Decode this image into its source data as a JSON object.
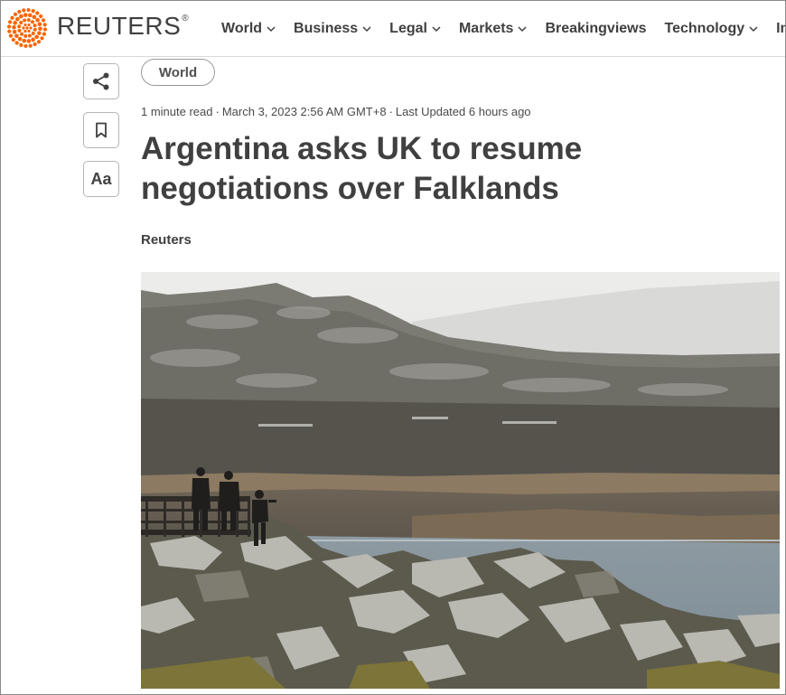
{
  "brand": {
    "name": "REUTERS",
    "registered": "®",
    "accent": "#fa6400"
  },
  "nav": {
    "items": [
      {
        "label": "World",
        "has_dropdown": true
      },
      {
        "label": "Business",
        "has_dropdown": true
      },
      {
        "label": "Legal",
        "has_dropdown": true
      },
      {
        "label": "Markets",
        "has_dropdown": true
      },
      {
        "label": "Breakingviews",
        "has_dropdown": false
      },
      {
        "label": "Technology",
        "has_dropdown": true
      },
      {
        "label": "Investiga",
        "has_dropdown": false
      }
    ]
  },
  "tools": {
    "share_icon": "share-icon",
    "bookmark_icon": "bookmark-icon",
    "text_size_label": "Aa"
  },
  "article": {
    "section": "World",
    "read_time": "1 minute read",
    "separator": "·",
    "published": "March 3, 2023 2:56 AM GMT+8",
    "updated": "Last Updated 6 hours ago",
    "headline": "Argentina asks UK to resume negotiations over Falklands",
    "byline": "Reuters"
  },
  "photo": {
    "subject": "people on a viewing platform above rocky coast and water"
  }
}
